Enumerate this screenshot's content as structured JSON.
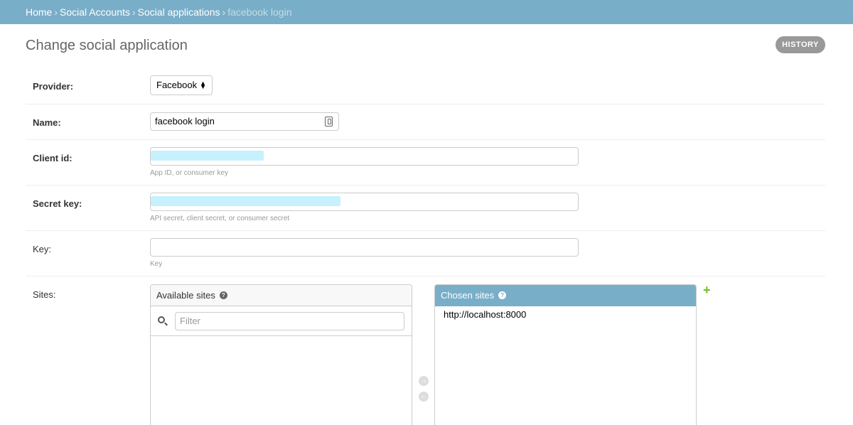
{
  "breadcrumbs": {
    "home": "Home",
    "social_accounts": "Social Accounts",
    "social_applications": "Social applications",
    "current": "facebook login",
    "separator": "›"
  },
  "title": "Change social application",
  "history_label": "HISTORY",
  "form": {
    "provider": {
      "label": "Provider:",
      "value": "Facebook"
    },
    "name": {
      "label": "Name:",
      "value": "facebook login",
      "icon": "contact-card-icon"
    },
    "client_id": {
      "label": "Client id:",
      "help": "App ID, or consumer key"
    },
    "secret_key": {
      "label": "Secret key:",
      "help": "API secret, client secret, or consumer secret"
    },
    "key": {
      "label": "Key:",
      "value": "",
      "help": "Key"
    },
    "sites": {
      "label": "Sites:",
      "available_title": "Available sites",
      "filter_placeholder": "Filter",
      "available_options": [],
      "chosen_title": "Chosen sites",
      "chosen_options": [
        "http://localhost:8000"
      ],
      "add_label": "+"
    }
  },
  "colors": {
    "header": "#79aec8",
    "history_button": "#999999",
    "add_link": "#70bf2b",
    "redaction": "#c6f1ff"
  }
}
